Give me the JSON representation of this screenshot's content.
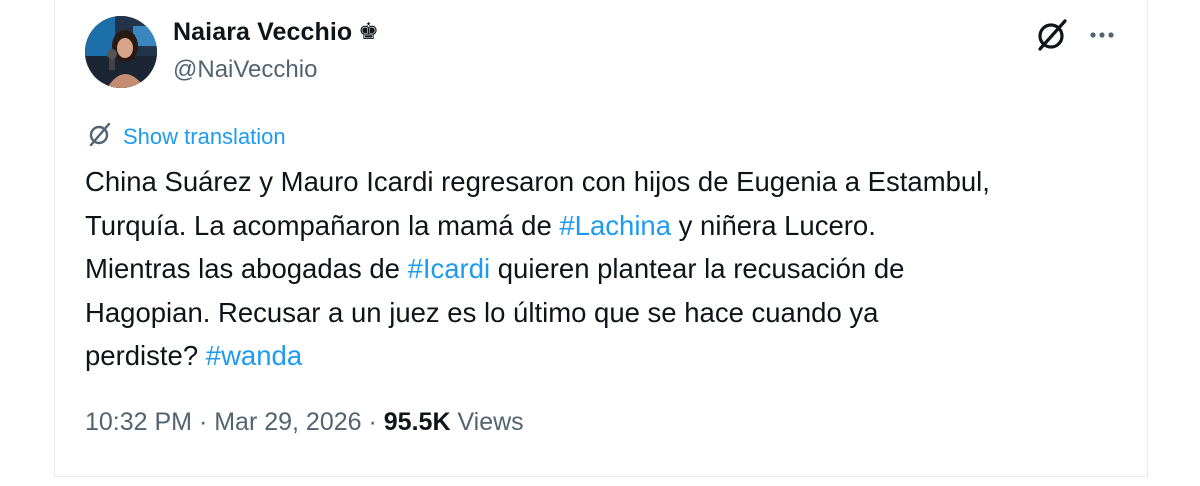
{
  "author": {
    "display_name": "Naiara Vecchio",
    "badge_icon": "crown-icon",
    "badge_glyph": "♚",
    "handle": "@NaiVecchio"
  },
  "actions": {
    "grok_icon": "grok-icon",
    "more_icon": "more-icon"
  },
  "translation": {
    "label": "Show translation"
  },
  "tweet": {
    "segments": [
      {
        "text": "China Suárez y Mauro Icardi regresaron con hijos de Eugenia a Estambul,\nTurquía. La acompañaron la mamá de ",
        "type": "text"
      },
      {
        "text": "#Lachina",
        "type": "hashtag"
      },
      {
        "text": " y niñera Lucero.\nMientras las abogadas de ",
        "type": "text"
      },
      {
        "text": "#Icardi",
        "type": "hashtag"
      },
      {
        "text": " quieren plantear la recusación de\nHagopian. Recusar a un juez es lo último que se hace cuando ya\nperdiste? ",
        "type": "text"
      },
      {
        "text": "#wanda",
        "type": "hashtag"
      }
    ]
  },
  "meta": {
    "time": "10:32 PM",
    "separator": " · ",
    "date": "Mar 29, 2026",
    "views_count": "95.5K",
    "views_label": " Views"
  },
  "colors": {
    "link": "#1d9bf0",
    "text": "#0f1419",
    "secondary": "#536471"
  }
}
